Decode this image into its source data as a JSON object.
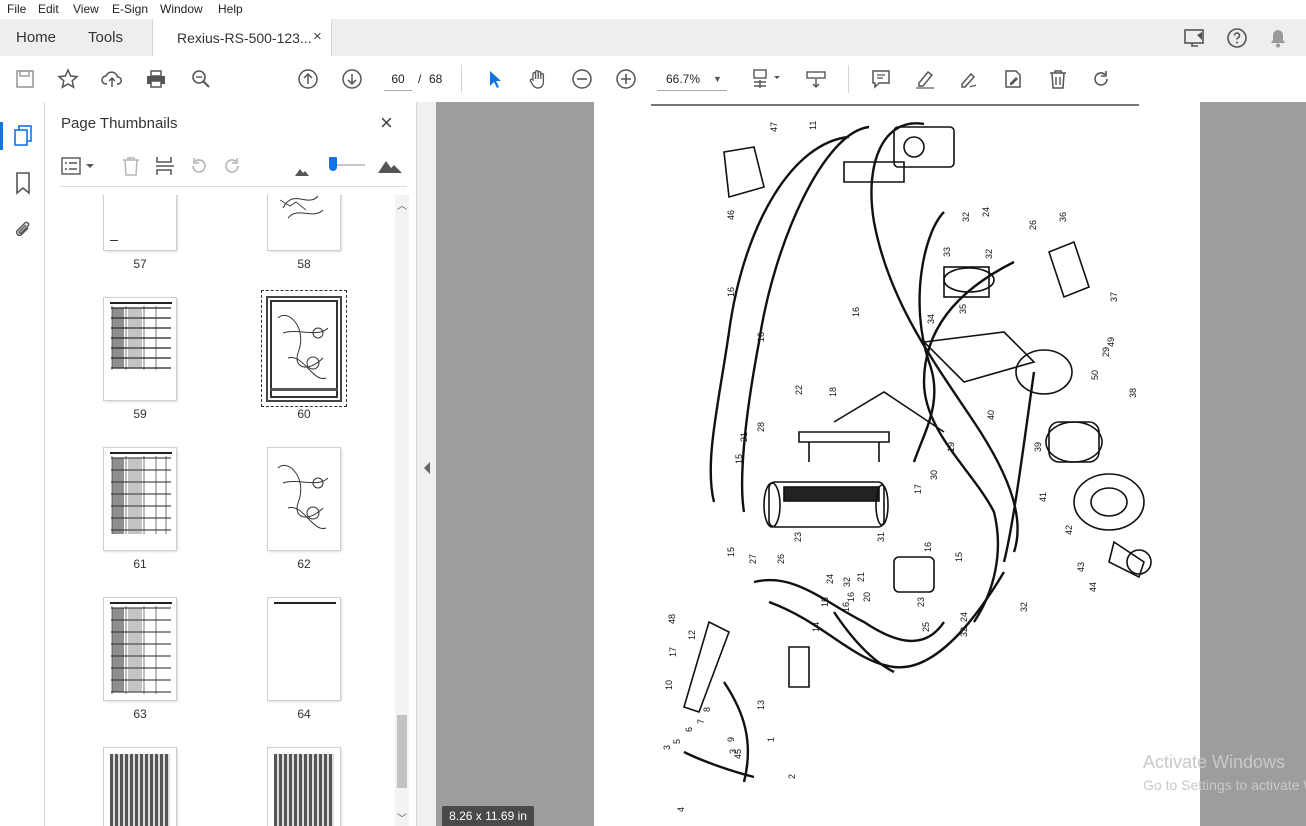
{
  "menu": [
    "File",
    "Edit",
    "View",
    "E-Sign",
    "Window",
    "Help"
  ],
  "tabs": {
    "home": "Home",
    "tools": "Tools",
    "document": "Rexius-RS-500-123...",
    "close": "×"
  },
  "toolbar": {
    "current_page": "60",
    "page_separator": "/",
    "total_pages": "68",
    "zoom": "66.7%"
  },
  "panel": {
    "title": "Page Thumbnails",
    "close": "×"
  },
  "thumbnails": [
    {
      "label": "57"
    },
    {
      "label": "58"
    },
    {
      "label": "59"
    },
    {
      "label": "60",
      "selected": true
    },
    {
      "label": "61"
    },
    {
      "label": "62"
    },
    {
      "label": "63"
    },
    {
      "label": "64"
    }
  ],
  "page_size": "8.26 x 11.69 in",
  "watermark": {
    "line1": "Activate Windows",
    "line2": "Go to Settings to activate Windows."
  },
  "diagram_labels": [
    "47",
    "11",
    "46",
    "16",
    "16",
    "16",
    "32",
    "24",
    "26",
    "36",
    "33",
    "32",
    "37",
    "34",
    "35",
    "29",
    "49",
    "50",
    "38",
    "22",
    "18",
    "40",
    "19",
    "39",
    "21",
    "28",
    "15",
    "30",
    "17",
    "41",
    "42",
    "15",
    "27",
    "23",
    "31",
    "26",
    "24",
    "32",
    "21",
    "16",
    "15",
    "32",
    "16",
    "20",
    "23",
    "25",
    "43",
    "44",
    "48",
    "12",
    "17",
    "10",
    "14",
    "15",
    "16",
    "8",
    "7",
    "6",
    "5",
    "3",
    "9",
    "3",
    "45",
    "4",
    "2",
    "1",
    "13",
    "24",
    "32"
  ],
  "colors": {
    "accent": "#1473e6",
    "viewer_bg": "#9d9d9d",
    "tabbar_bg": "#eeeeee"
  }
}
